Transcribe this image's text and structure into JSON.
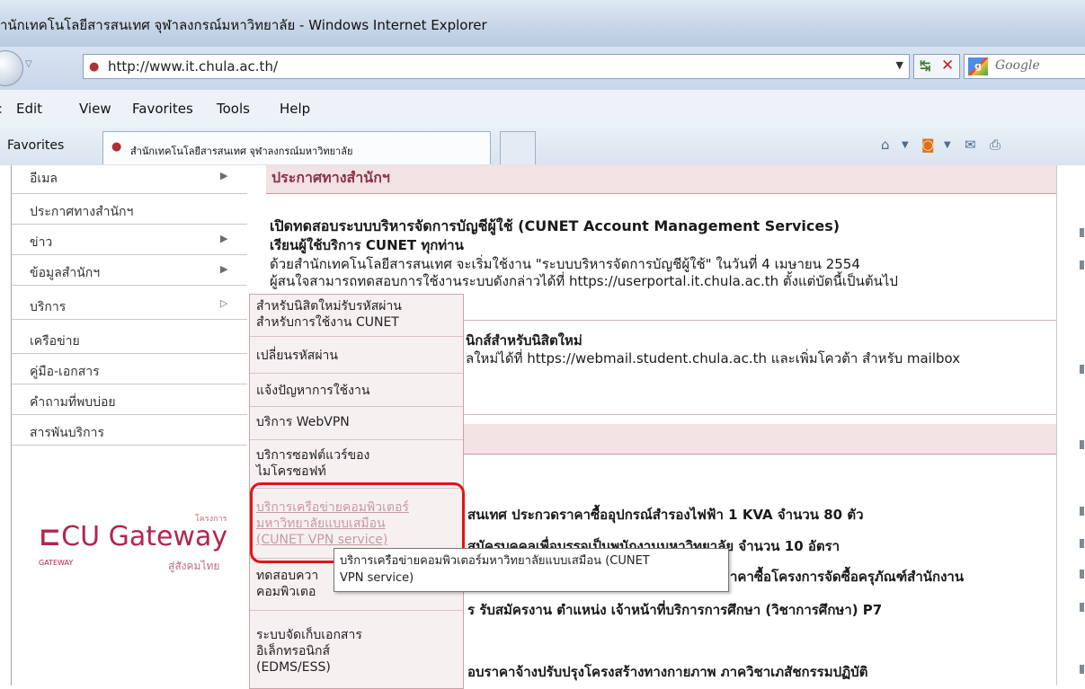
{
  "browser": {
    "title": "านักเทคโนโลยีสารสนเทศ จุฬาลงกรณ์มหาวิทยาลัย - Windows Internet Explorer",
    "url": "http://www.it.chula.ac.th/",
    "search_placeholder": "Google",
    "menu": [
      "Edit",
      "View",
      "Favorites",
      "Tools",
      "Help"
    ],
    "favorites_label": "Favorites",
    "tab_title": "สำนักเทคโนโลยีสารสนเทศ จุฬาลงกรณ์มหาวิทยาลัย"
  },
  "left_nav": {
    "items": [
      {
        "label": "อีเมล",
        "arrow": "▶"
      },
      {
        "label": "ประกาศทางสำนักฯ",
        "arrow": ""
      },
      {
        "label": "ข่าว",
        "arrow": "▶"
      },
      {
        "label": "ข้อมูลสำนักฯ",
        "arrow": "▶"
      },
      {
        "label": "บริการ",
        "arrow": "▷"
      },
      {
        "label": "เครือข่าย",
        "arrow": ""
      },
      {
        "label": "คู่มือ-เอกสาร",
        "arrow": ""
      },
      {
        "label": "คำถามที่พบบ่อย",
        "arrow": ""
      },
      {
        "label": "สารพันบริการ",
        "arrow": ""
      }
    ]
  },
  "logo": {
    "brand": "CU Gateway",
    "small_top": "โครงการ",
    "small_gateway": "GATEWAY",
    "tagline": "สู่สังคมไทย"
  },
  "dropdown": {
    "items": [
      "สำหรับนิสิตใหม่รับรหัสผ่าน\nสำหรับการใช้งาน CUNET",
      "เปลี่ยนรหัสผ่าน",
      "แจ้งปัญหาการใช้งาน",
      "บริการ WebVPN",
      "บริการซอฟต์แวร์ของ\nไมโครซอฟท์",
      "บริการเครือข่ายคอมพิวเตอร์\nมหาวิทยาลัยแบบเสมือน\n(CUNET VPN service)",
      "ทดสอบควา\nคอมพิวเตอ",
      "ระบบจัดเก็บเอกสาร\nอิเล็กทรอนิกส์\n(EDMS/ESS)"
    ]
  },
  "tooltip": "บริการเครือข่ายคอมพิวเตอร์มหาวิทยาลัยแบบเสมือน (CUNET\nVPN service)",
  "main": {
    "section_title": "ประกาศทางสำนักฯ",
    "ann1_title": "เปิดทดสอบระบบบริหารจัดการบัญชีผู้ใช้ (CUNET Account Management Services)",
    "ann1_sub": "เรียนผู้ใช้บริการ CUNET ทุกท่าน",
    "ann1_line1": "ด้วยสำนักเทคโนโลยีสารสนเทศ จะเริ่มใช้งาน \"ระบบบริหารจัดการบัญชีผู้ใช้\" ในวันที่ 4 เมษายน 2554",
    "ann1_line2": "ผู้สนใจสามารถทดสอบการใช้งานระบบดังกล่าวได้ที่ https://userportal.it.chula.ac.th ตั้งแต่บัดนี้เป็นต้นไป",
    "ann2_title": "นิกส์สำหรับนิสิตใหม่",
    "ann2_line": "ลใหม่ได้ที่ https://webmail.student.chula.ac.th และเพิ่มโควต้า สำหรับ mailbox",
    "news1": "สนเทศ ประกวดราคาซื้ออุปกรณ์สำรองไฟฟ้า 1 KVA จำนวน 80 ตัว",
    "news2": "สมัครบุคคลเพื่อบรรจุเป็นพนักงานมหาวิทยาลัย จำนวน 10 อัตรา",
    "news3": "าคาซื้อโครงการจัดซื้อครุภัณฑ์สำนักงาน",
    "news4": "ร รับสมัครงาน ตำแหน่ง เจ้าหน้าที่บริการการศึกษา (วิชาการศึกษา) P7",
    "news5": "อบราคาจ้างปรับปรุงโครงสร้างทางกายภาพ ภาควิชาเภสัชกรรมปฏิบัติ"
  }
}
